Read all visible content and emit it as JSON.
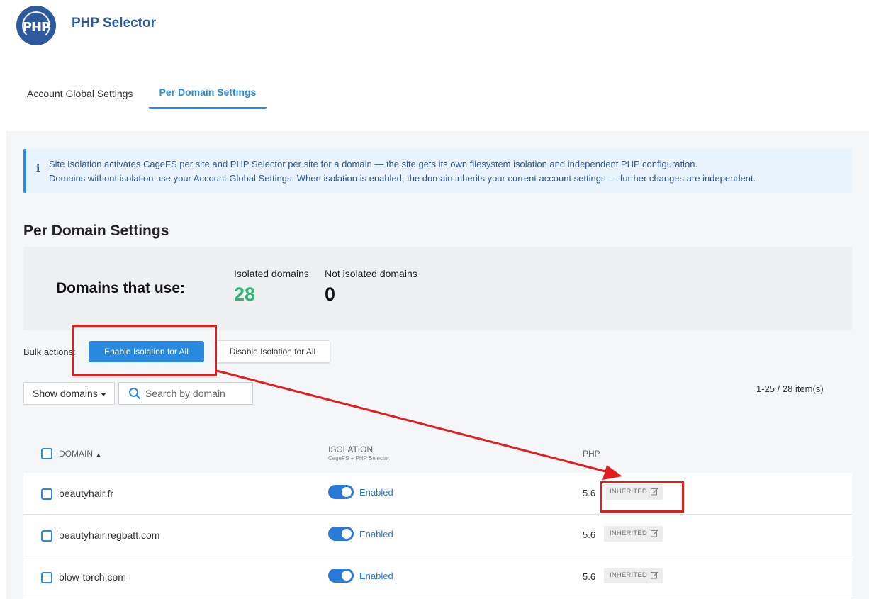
{
  "app": {
    "logo_text": "PHP",
    "title": "PHP Selector"
  },
  "tabs": [
    {
      "label": "Account Global Settings",
      "active": false
    },
    {
      "label": "Per Domain Settings",
      "active": true
    }
  ],
  "info": {
    "icon": "info-icon",
    "line1": "Site Isolation activates CageFS per site and PHP Selector per site for a domain — the site gets its own filesystem isolation and independent PHP configuration.",
    "line2": "Domains without isolation use your Account Global Settings. When isolation is enabled, the domain inherits your current account settings — further changes are independent."
  },
  "section": {
    "title": "Per Domain Settings"
  },
  "stats": {
    "label": "Domains that use:",
    "isolated_label": "Isolated domains",
    "isolated_value": "28",
    "not_isolated_label": "Not isolated domains",
    "not_isolated_value": "0"
  },
  "bulk": {
    "label": "Bulk actions:",
    "enable_label": "Enable Isolation for All",
    "disable_label": "Disable Isolation for All"
  },
  "filter": {
    "show_domains_label": "Show domains",
    "search_placeholder": "Search by domain",
    "pager": "1-25 / 28 item(s)"
  },
  "table": {
    "headers": {
      "domain": "Domain",
      "isolation": "Isolation",
      "isolation_sub": "CageFS + PHP Selector",
      "php": "PHP"
    },
    "rows": [
      {
        "domain": "beautyhair.fr",
        "isolation": "Enabled",
        "php": "5.6",
        "badge": "INHERITED"
      },
      {
        "domain": "beautyhair.regbatt.com",
        "isolation": "Enabled",
        "php": "5.6",
        "badge": "INHERITED"
      },
      {
        "domain": "blow-torch.com",
        "isolation": "Enabled",
        "php": "5.6",
        "badge": "INHERITED"
      }
    ]
  },
  "colors": {
    "brand": "#2d5a9c",
    "accent": "#2a8ae0",
    "green": "#2bb673",
    "annotation": "#e01e1e"
  }
}
